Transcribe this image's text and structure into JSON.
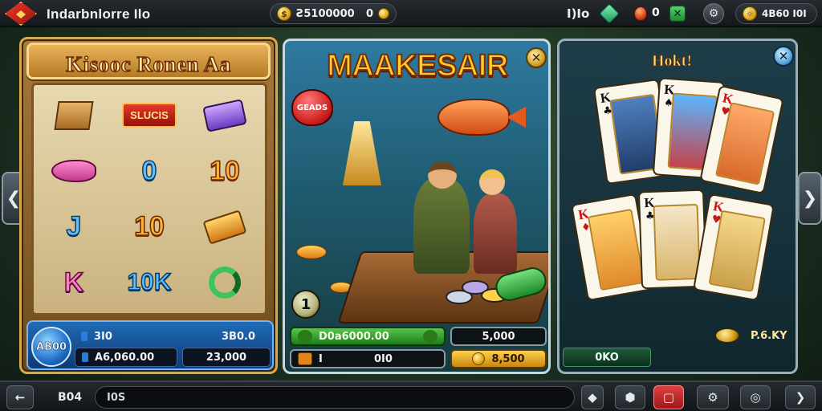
{
  "header": {
    "app_title": "Indarbnlorre Ilo",
    "balance_pill": "Ƨ100000",
    "balance_icon_glyph": "Ƨ",
    "balance_value": "Ƨ5100000",
    "balance_zero": "0",
    "left_status": "I)Io",
    "gem_count": "0",
    "right_coin_value": "4B60 I0I"
  },
  "left_panel": {
    "title": "Kisooc Ronen Aa",
    "reel_rows": [
      [
        "",
        "SLUCIS",
        ""
      ],
      [
        "",
        "0",
        "10"
      ],
      [
        "J",
        "10",
        ""
      ],
      [
        "K",
        "10K",
        ""
      ]
    ],
    "spin_label": "AB00",
    "footer": {
      "row1_left": "3I0",
      "row1_right": "3B0.0",
      "row2_left": "A6,060.00",
      "row2_right": "23,000"
    }
  },
  "mid_panel": {
    "title": "MAAKESAIR",
    "badge": "GEADS",
    "round_number": "1",
    "green_bar_text": "D0a6000.00",
    "dark_bar_right": "5,000",
    "bottom_left_text": "0I0",
    "bottom_left_glyph": "I",
    "gold_bar_text": "8,500"
  },
  "right_panel": {
    "title": "Hokt!",
    "label": "P.6.KY",
    "bottom_bar": "0KO",
    "cards": [
      {
        "rank": "K",
        "suit": "♣",
        "color": "black"
      },
      {
        "rank": "K",
        "suit": "♠",
        "color": "black"
      },
      {
        "rank": "K",
        "suit": "♥",
        "color": "red"
      },
      {
        "rank": "K",
        "suit": "♦",
        "color": "red"
      },
      {
        "rank": "K",
        "suit": "♣",
        "color": "black"
      },
      {
        "rank": "K",
        "suit": "♥",
        "color": "red"
      }
    ]
  },
  "bottombar": {
    "back_glyph": "←",
    "left_label": "B04",
    "input_value": "I0S",
    "icons": [
      "diamond-icon",
      "shield-icon",
      "stop-icon",
      "gear-icon",
      "target-icon",
      "forward-icon"
    ]
  },
  "colors": {
    "accent_gold": "#ffcc2e",
    "panel_wood": "#a77a3d",
    "panel_blue": "#2f7aa1",
    "panel_dark": "#1e3d48"
  }
}
